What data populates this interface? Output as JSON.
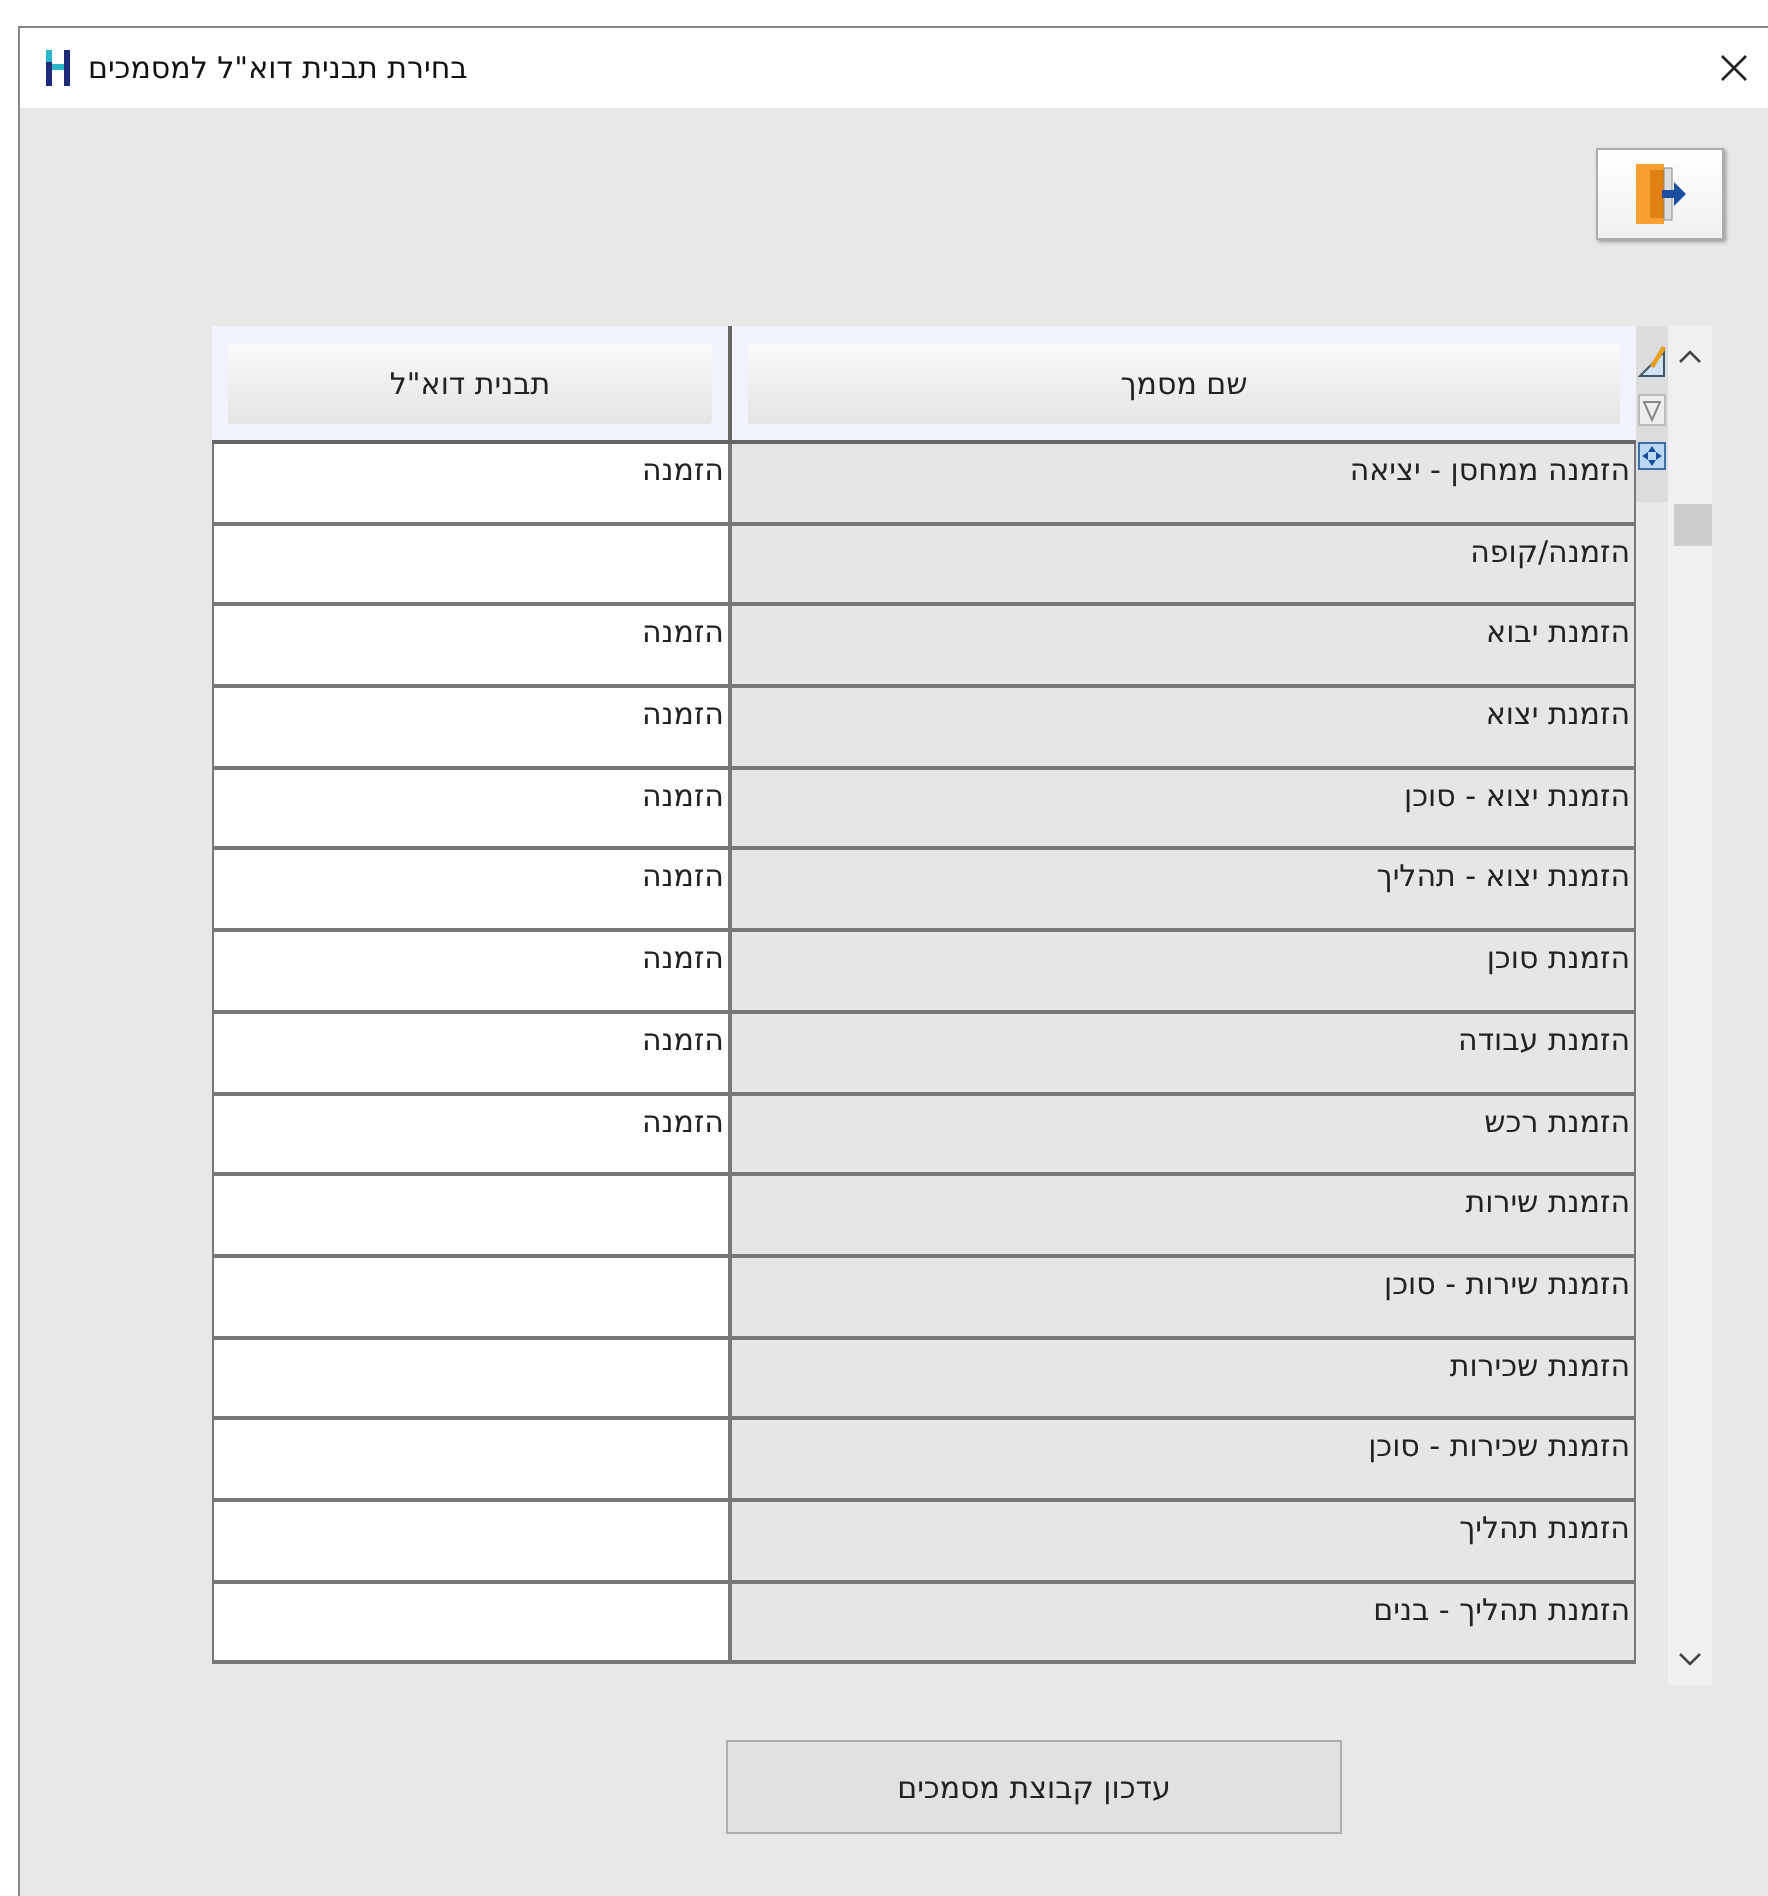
{
  "window": {
    "title": "בחירת תבנית דוא\"ל למסמכים"
  },
  "table": {
    "columns": [
      "שם מסמך",
      "תבנית דוא\"ל"
    ],
    "rows": [
      {
        "name": "הזמנה ממחסן - יציאה",
        "template": "הזמנה"
      },
      {
        "name": "הזמנה/קופה"
      },
      {
        "name": "הזמנת יבוא",
        "template": "הזמנה"
      },
      {
        "name": "הזמנת יצוא",
        "template": "הזמנה"
      },
      {
        "name": "הזמנת יצוא - סוכן",
        "template": "הזמנה"
      },
      {
        "name": "הזמנת יצוא - תהליך",
        "template": "הזמנה"
      },
      {
        "name": "הזמנת סוכן",
        "template": "הזמנה"
      },
      {
        "name": "הזמנת עבודה",
        "template": "הזמנה"
      },
      {
        "name": "הזמנת רכש",
        "template": "הזמנה"
      },
      {
        "name": "הזמנת שירות"
      },
      {
        "name": "הזמנת שירות - סוכן"
      },
      {
        "name": "הזמנת שכירות"
      },
      {
        "name": "הזמנת שכירות - סוכן"
      },
      {
        "name": "הזמנת תהליך"
      },
      {
        "name": "הזמנת תהליך - בנים"
      }
    ]
  },
  "update_button": "עדכון קבוצת מסמכים"
}
